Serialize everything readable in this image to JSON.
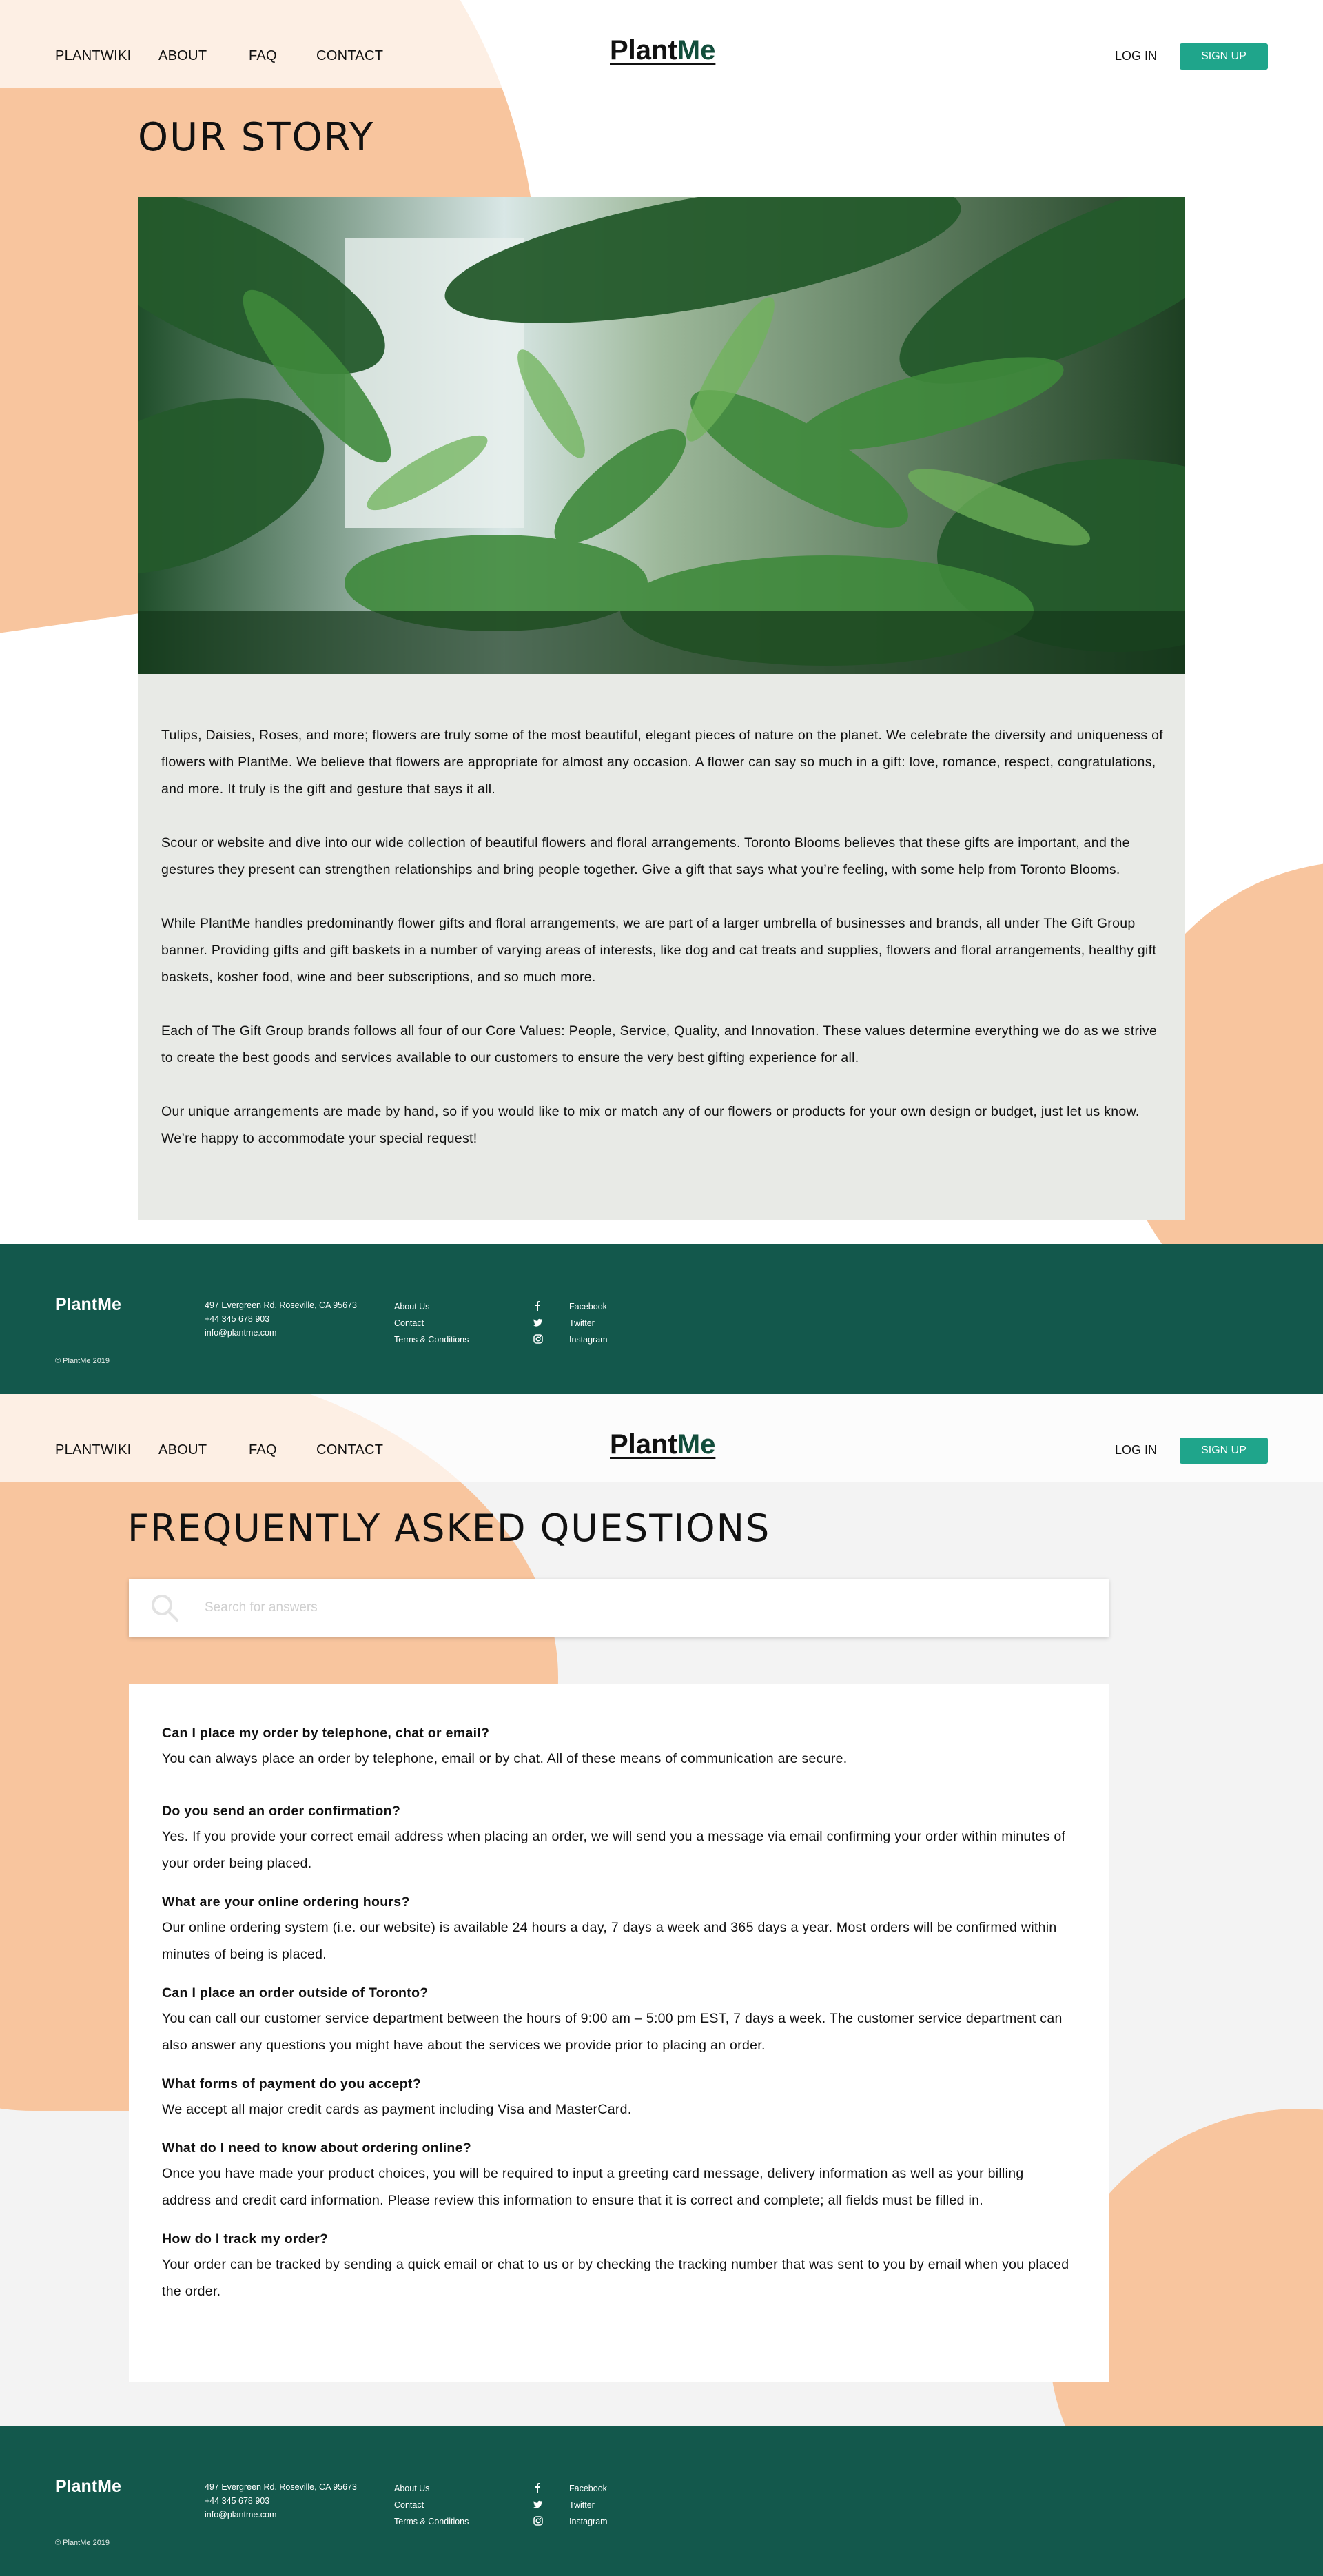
{
  "nav": {
    "links": [
      "PLANTWIKI",
      "ABOUT",
      "FAQ",
      "CONTACT"
    ],
    "logo_part1": "Plant",
    "logo_part2": "Me",
    "login": "LOG IN",
    "signup": "SIGN UP"
  },
  "story": {
    "title": "OUR STORY",
    "paragraphs": [
      "Tulips, Daisies, Roses, and more; flowers are truly some of the most beautiful, elegant pieces of nature on the planet. We celebrate the diversity and uniqueness of flowers with PlantMe. We believe that flowers are appropriate for almost any occasion. A flower can say so much in a gift: love, romance, respect, congratulations, and more. It truly is the gift and gesture that says it all.",
      "Scour or website and dive into our wide collection of beautiful flowers and floral arrangements. Toronto Blooms believes that these gifts are important, and the gestures they present can strengthen relationships and bring people together. Give a gift that says what you’re feeling, with some help from Toronto Blooms.",
      "While PlantMe handles predominantly flower gifts and floral arrangements, we are part of a larger umbrella of businesses and brands, all under The Gift Group banner. Providing gifts and gift baskets in a number of varying areas of interests, like dog and cat treats and supplies, flowers and floral arrangements, healthy gift baskets, kosher food, wine and beer subscriptions, and so much more.",
      "Each of The Gift Group brands follows all four of our Core Values: People, Service, Quality, and Innovation. These values determine everything we do as we strive to create the best goods and services available to our customers to ensure the very best gifting experience for all.",
      "Our unique arrangements are made by hand, so if you would like to mix or match any of our flowers or products for your own design or budget, just let us know. We’re happy to accommodate your special request!"
    ]
  },
  "footer": {
    "brand": "PlantMe",
    "address": "497 Evergreen Rd. Roseville, CA 95673",
    "phone": "+44 345 678 903",
    "email": "info@plantme.com",
    "links": [
      "About Us",
      "Contact",
      "Terms & Conditions"
    ],
    "social": [
      {
        "icon": "facebook-icon",
        "label": "Facebook"
      },
      {
        "icon": "twitter-icon",
        "label": "Twitter"
      },
      {
        "icon": "instagram-icon",
        "label": "Instagram"
      }
    ],
    "copyright": "© PlantMe 2019"
  },
  "faq": {
    "title": "FREQUENTLY ASKED QUESTIONS",
    "search_placeholder": "Search for answers",
    "items": [
      {
        "q": "Can I place my order by telephone, chat or email?",
        "a": "You can always place an order by telephone, email or by chat. All of these means of communication are secure."
      },
      {
        "q": "Do you send an order confirmation?",
        "a": "Yes. If you provide your correct email address when placing an order, we will send you a message via email confirming your order within minutes of your order being placed."
      },
      {
        "q": "What are your online ordering hours?",
        "a": "Our online ordering system (i.e. our website) is available 24 hours a day, 7 days a week and 365 days a year. Most orders will be confirmed within minutes of being is placed."
      },
      {
        "q": "Can I place an order outside of Toronto?",
        "a": "You can call our customer service department between the hours of 9:00 am – 5:00 pm EST, 7 days a week.  The customer service department can also answer any questions you might have about the services we provide prior to placing an order."
      },
      {
        "q": "What forms of payment do you accept?",
        "a": "We accept all major credit cards as payment including Visa and MasterCard."
      },
      {
        "q": "What do I need to know about ordering online?",
        "a": "Once you have made your product choices, you will be required to input a greeting card message, delivery information as well as your billing address and credit card information. Please review this information to ensure that it is correct and complete; all fields must be filled in."
      },
      {
        "q": "How do I track my order?",
        "a": "Your order can be tracked by sending a quick email or chat to us or by checking the tracking number that was sent to you by email when you placed the order."
      }
    ]
  },
  "colors": {
    "accent": "#1fa58b",
    "footer": "#13584c",
    "blob": "#f8c59e",
    "brand_dark": "#124d3b"
  }
}
